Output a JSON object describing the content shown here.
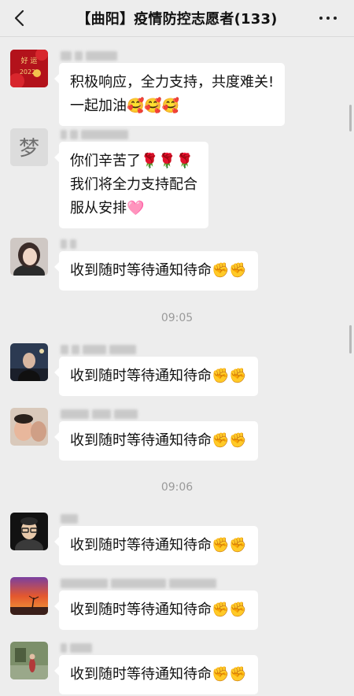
{
  "header": {
    "title": "【曲阳】疫情防控志愿者(133)",
    "back_icon": "chevron-left-icon",
    "more_icon": "more-dots-icon"
  },
  "avatars": {
    "a1_text": "2022"
  },
  "messages": [
    {
      "lines": [
        "积极响应，全力支持，共度难关!",
        "一起加油🥰🥰🥰"
      ]
    },
    {
      "lines": [
        "你们辛苦了🌹🌹🌹",
        "我们将全力支持配合",
        "服从安排🩷"
      ]
    },
    {
      "lines": [
        "收到随时等待通知待命✊✊"
      ]
    },
    {
      "lines": [
        "收到随时等待通知待命✊✊"
      ]
    },
    {
      "lines": [
        "收到随时等待通知待命✊✊"
      ]
    },
    {
      "lines": [
        "收到随时等待通知待命✊✊"
      ]
    },
    {
      "lines": [
        "收到随时等待通知待命✊✊"
      ]
    },
    {
      "lines": [
        "收到随时等待通知待命✊✊"
      ]
    }
  ],
  "timestamps": [
    "09:05",
    "09:06"
  ],
  "colors": {
    "background": "#ededed",
    "bubble": "#ffffff",
    "timestamp": "#9a9a9a"
  }
}
